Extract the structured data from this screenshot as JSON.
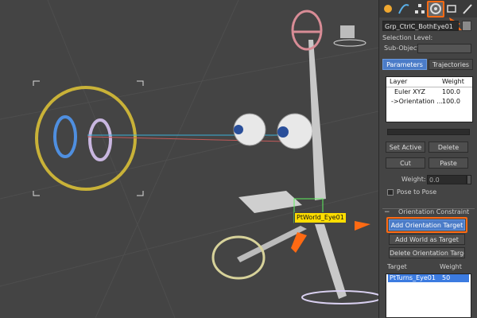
{
  "viewport": {
    "target_label": "PtWorld_Eye01"
  },
  "command_panel": {
    "tabs": [
      "create-tab",
      "modify-tab",
      "hierarchy-tab",
      "motion-tab",
      "display-tab",
      "utilities-tab"
    ],
    "object_name": "Grp_CtrlC_BothEye01",
    "selection_level_label": "Selection Level:",
    "sub_object_label": "Sub-Object",
    "parameters_tab": "Parameters",
    "trajectories_tab": "Trajectories",
    "layer_list": {
      "headers": [
        "Layer",
        "Weight"
      ],
      "rows": [
        {
          "layer": "Euler XYZ",
          "weight": "100.0"
        },
        {
          "layer": "->Orientation ...",
          "weight": "100.0"
        }
      ]
    },
    "buttons": {
      "set_active": "Set Active",
      "delete": "Delete",
      "cut": "Cut",
      "paste": "Paste"
    },
    "weight_label": "Weight:",
    "weight_value": "0.0",
    "pose_to_pose": "Pose to Pose",
    "orientation_constraint_title": "Orientation Constraint",
    "add_orientation_target": "Add Orientation Target",
    "add_world_as_target": "Add World as Target",
    "delete_orientation_target": "Delete Orientation Target",
    "target_list": {
      "headers": [
        "Target",
        "Weight"
      ],
      "rows": [
        {
          "target": "PtTurns_Eye01",
          "weight": "50"
        }
      ]
    }
  },
  "colors": {
    "highlight": "#ff6a13",
    "selection_blue": "#4b7cc8",
    "label_yellow": "#ffdd00"
  }
}
